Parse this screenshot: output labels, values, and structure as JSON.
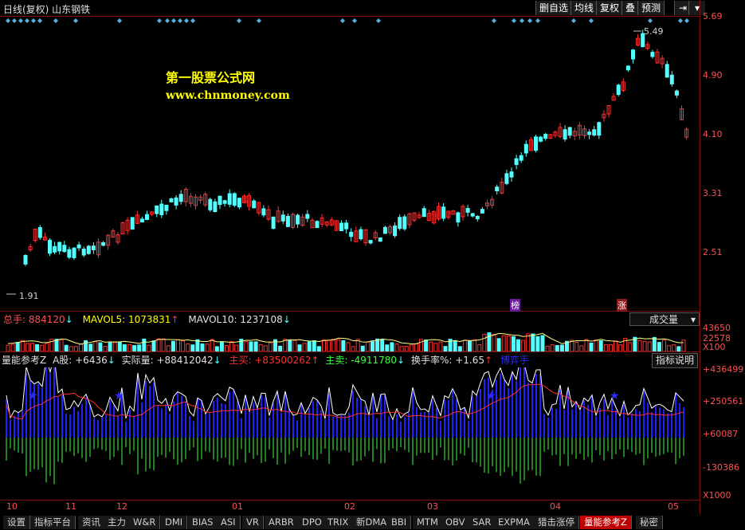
{
  "header": {
    "title": "日线(复权)  山东钢铁",
    "buttons": [
      "删自选",
      "均线",
      "复权",
      "叠",
      "预测"
    ]
  },
  "main_chart": {
    "watermark_title": "第一股票公式网",
    "watermark_url": "www.chnmoney.com",
    "price_labels": [
      "5.69",
      "4.90",
      "4.10",
      "3.31",
      "2.51"
    ],
    "high_marker": "5.49",
    "low_marker": "1.91",
    "badge_1": "榜",
    "badge_2": "涨"
  },
  "volume_panel": {
    "label_total": "总手: 884120",
    "label_ma5": "MAVOL5: 1073831",
    "label_ma10": "MAVOL10: 1237108",
    "dropdown": "成交量",
    "axis": [
      "43650",
      "22578",
      "X100"
    ]
  },
  "indicator_panel": {
    "name": "量能参考Z",
    "a_shares": "A股: +6436",
    "actual": "实际量: +88412042",
    "main_buy": "主买: +83500262",
    "main_sell": "主卖: -4911780",
    "turnover": "换手率%: +1.65",
    "extra": "博弈手",
    "help_button": "指标说明",
    "axis": [
      "+436499",
      "+250561",
      "+60087",
      "-130386",
      "X1000"
    ]
  },
  "date_axis": [
    "10",
    "11",
    "12",
    "01",
    "02",
    "03",
    "04",
    "05"
  ],
  "bottom_tabs": [
    "设置",
    "指标平台",
    "资讯",
    "主力",
    "W&R",
    "DMI",
    "BIAS",
    "ASI",
    "VR",
    "ARBR",
    "DPO",
    "TRIX",
    "新DMA",
    "BBI",
    "MTM",
    "OBV",
    "SAR",
    "EXPMA",
    "猎击涨停",
    "量能参考Z",
    "秘密"
  ],
  "colors": {
    "up": "#ff3030",
    "down": "#54ffff",
    "grid": "#7a1010",
    "accent": "#ffff00"
  }
}
